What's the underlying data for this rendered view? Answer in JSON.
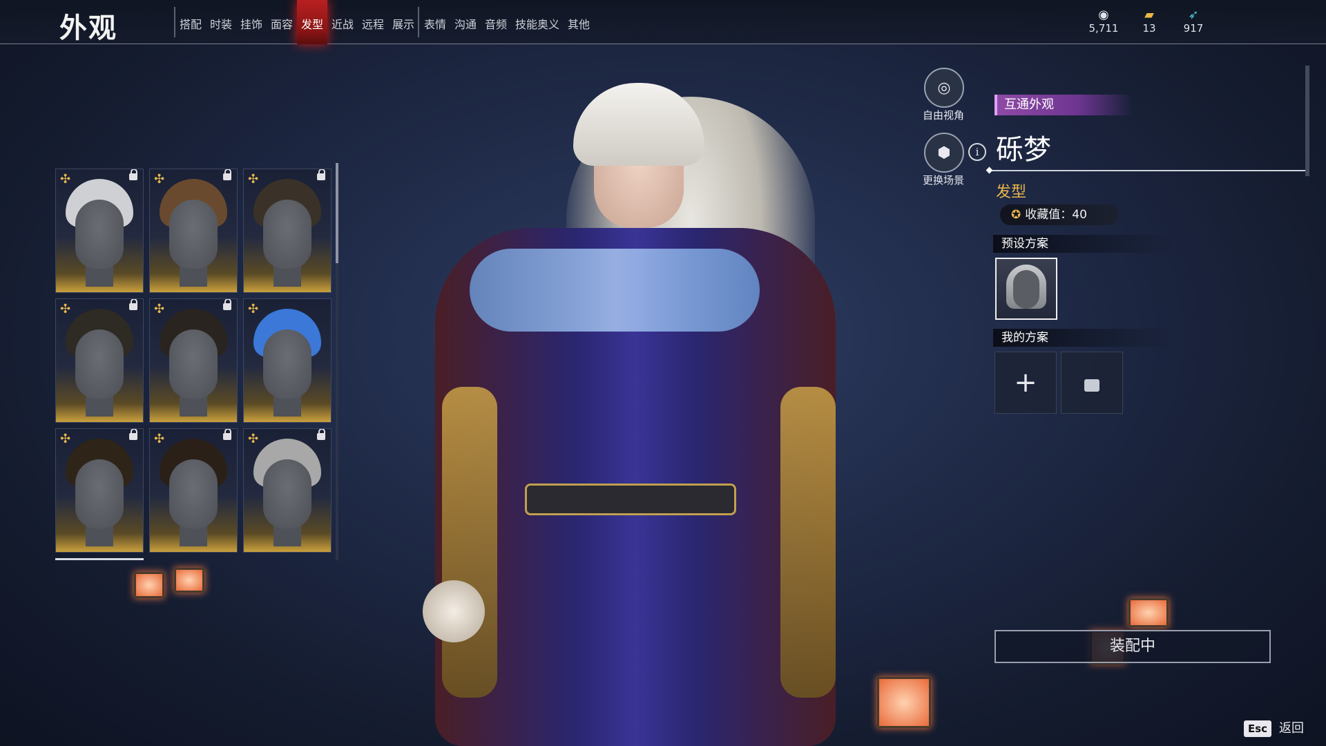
{
  "header": {
    "title": "外观",
    "tabs": [
      "搭配",
      "时装",
      "挂饰",
      "面容",
      "发型",
      "近战",
      "远程",
      "展示",
      "表情",
      "沟通",
      "音频",
      "技能奥义",
      "其他"
    ],
    "active_tab": "发型",
    "currencies": [
      {
        "icon": "coin-icon",
        "value": "5,711"
      },
      {
        "icon": "ticket-icon",
        "value": "13"
      },
      {
        "icon": "feather-icon",
        "value": "917"
      }
    ]
  },
  "grid": {
    "items": [
      {
        "hair_color": "#cfd0d4",
        "locked": true
      },
      {
        "hair_color": "#6a4a2e",
        "locked": true
      },
      {
        "hair_color": "#3a3228",
        "locked": true
      },
      {
        "hair_color": "#2e2a24",
        "locked": true
      },
      {
        "hair_color": "#2a2420",
        "locked": true
      },
      {
        "hair_color": "#3b78d8",
        "locked": false
      },
      {
        "hair_color": "#2e2418",
        "locked": true
      },
      {
        "hair_color": "#2a2018",
        "locked": true
      },
      {
        "hair_color": "#a8a8a8",
        "locked": true
      }
    ]
  },
  "camera": {
    "free_view_label": "自由视角",
    "change_scene_label": "更换场景"
  },
  "detail": {
    "tag": "互通外观",
    "name": "砾梦",
    "type": "发型",
    "collect_label": "收藏值：40",
    "preset_header": "预设方案",
    "my_header": "我的方案",
    "equip_label": "装配中"
  },
  "footer": {
    "esc_key": "Esc",
    "back_label": "返回"
  }
}
